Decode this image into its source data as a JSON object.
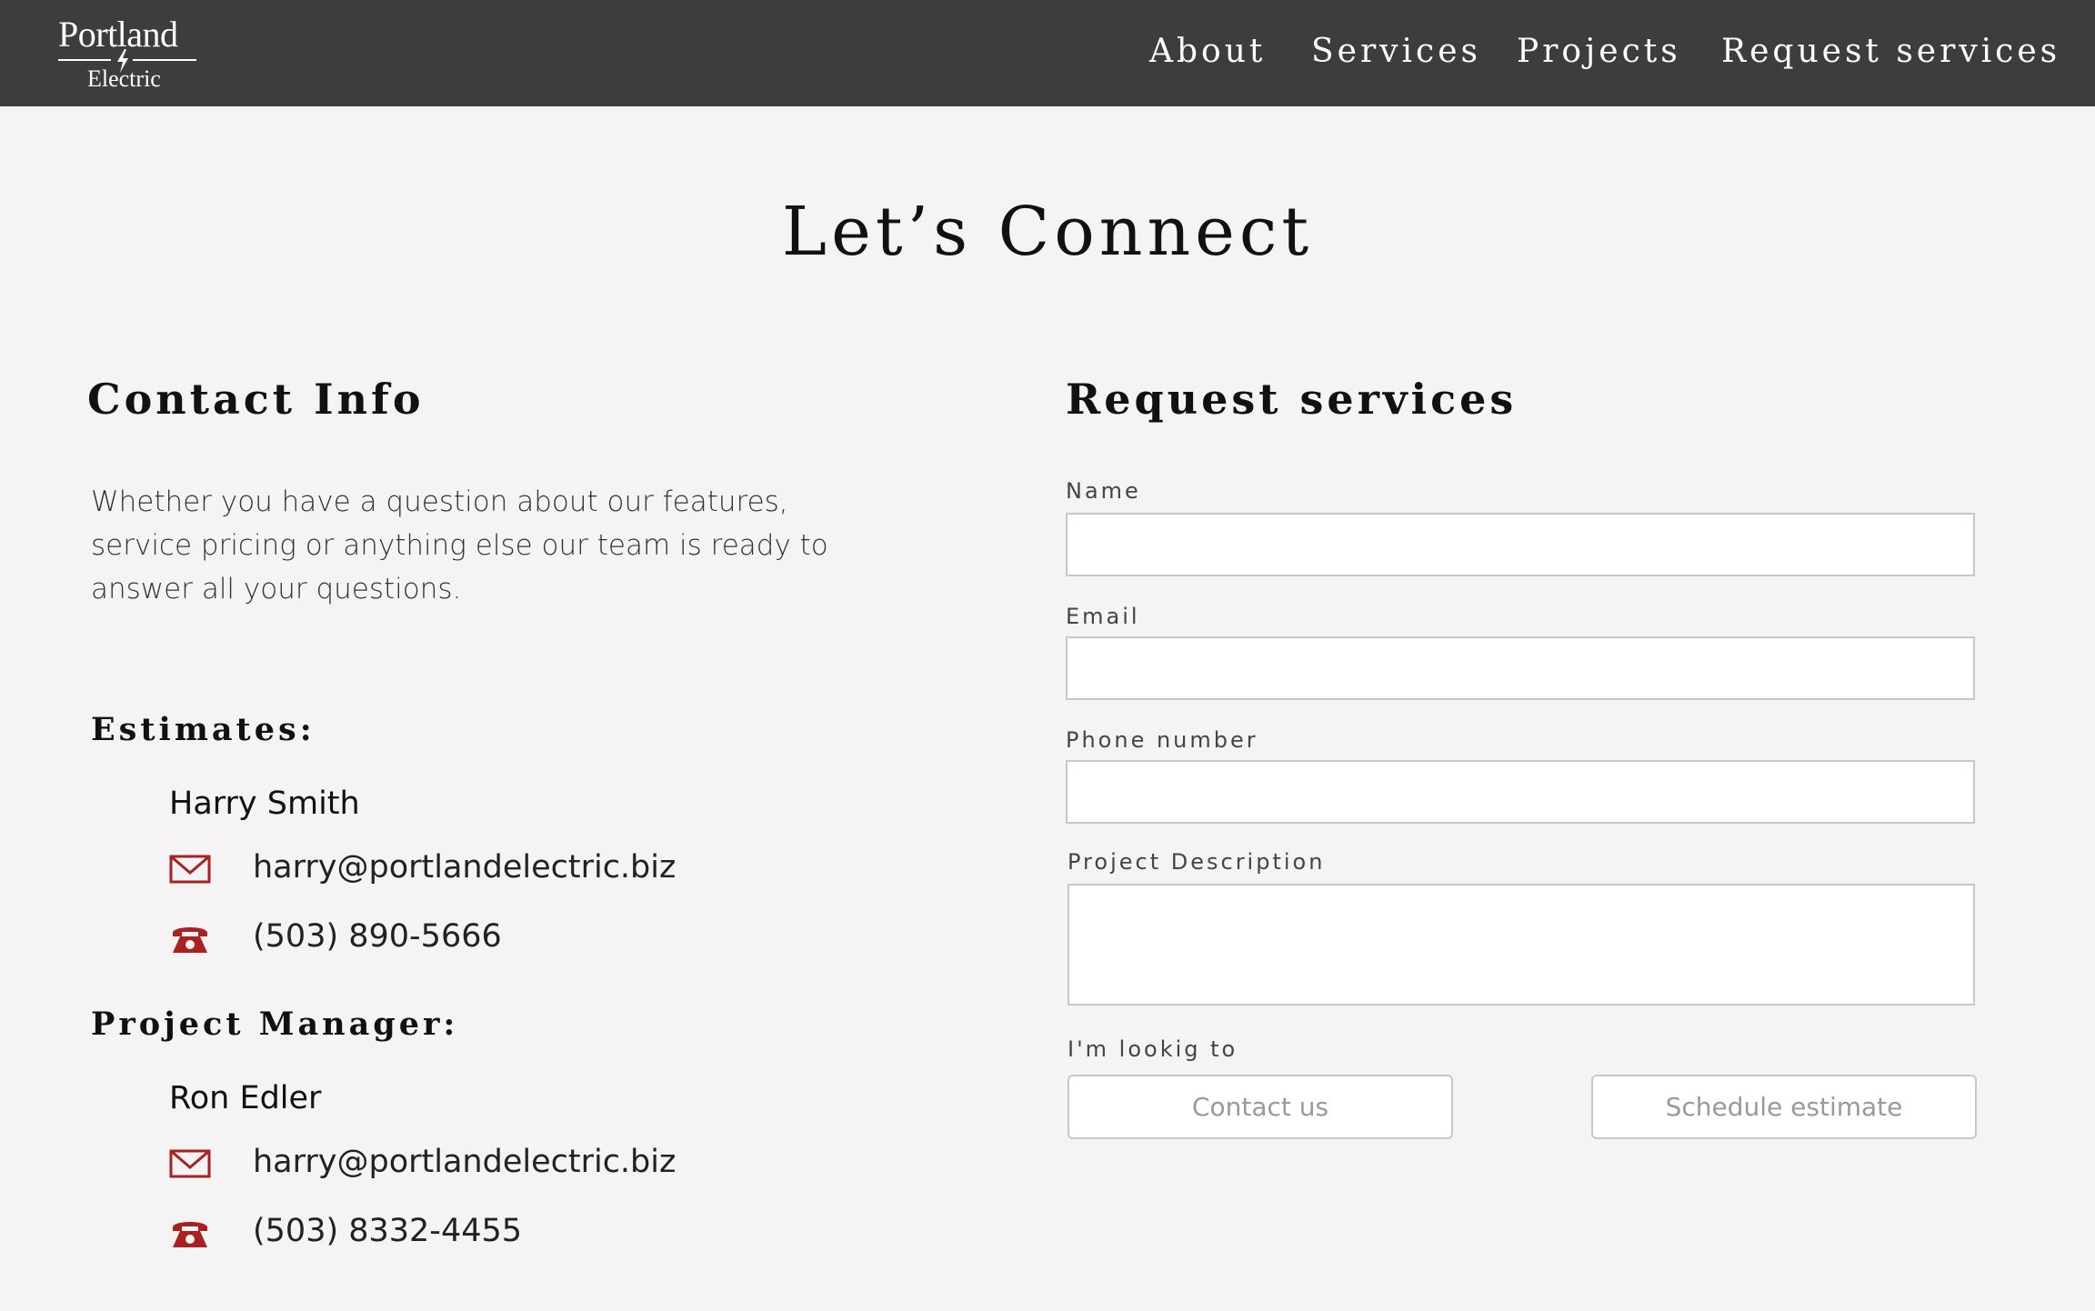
{
  "brand": {
    "name_top": "Portland",
    "name_bottom": "Electric",
    "accent_icon_color": "#a82222",
    "header_bg": "#3d3d3d"
  },
  "nav": {
    "about": "About",
    "services": "Services",
    "projects": "Projects",
    "request": "Request services"
  },
  "page": {
    "title": "Let’s Connect"
  },
  "contact_info": {
    "heading": "Contact Info",
    "intro": "Whether you have a question about our features, service pricing or anything else our team is ready to answer all your questions.",
    "estimates": {
      "heading": "Estimates:",
      "name": "Harry Smith",
      "email": "harry@portlandelectric.biz",
      "phone": "(503) 890-5666"
    },
    "project_manager": {
      "heading": "Project Manager:",
      "name": "Ron Edler",
      "email": "harry@portlandelectric.biz",
      "phone": "(503) 8332-4455"
    }
  },
  "request_form": {
    "heading": "Request services",
    "name_label": "Name",
    "email_label": "Email",
    "phone_label": "Phone number",
    "description_label": "Project Description",
    "looking_label": "I'm lookig to",
    "name_value": "",
    "email_value": "",
    "phone_value": "",
    "description_value": "",
    "option_contact": "Contact us",
    "option_estimate": "Schedule estimate"
  }
}
